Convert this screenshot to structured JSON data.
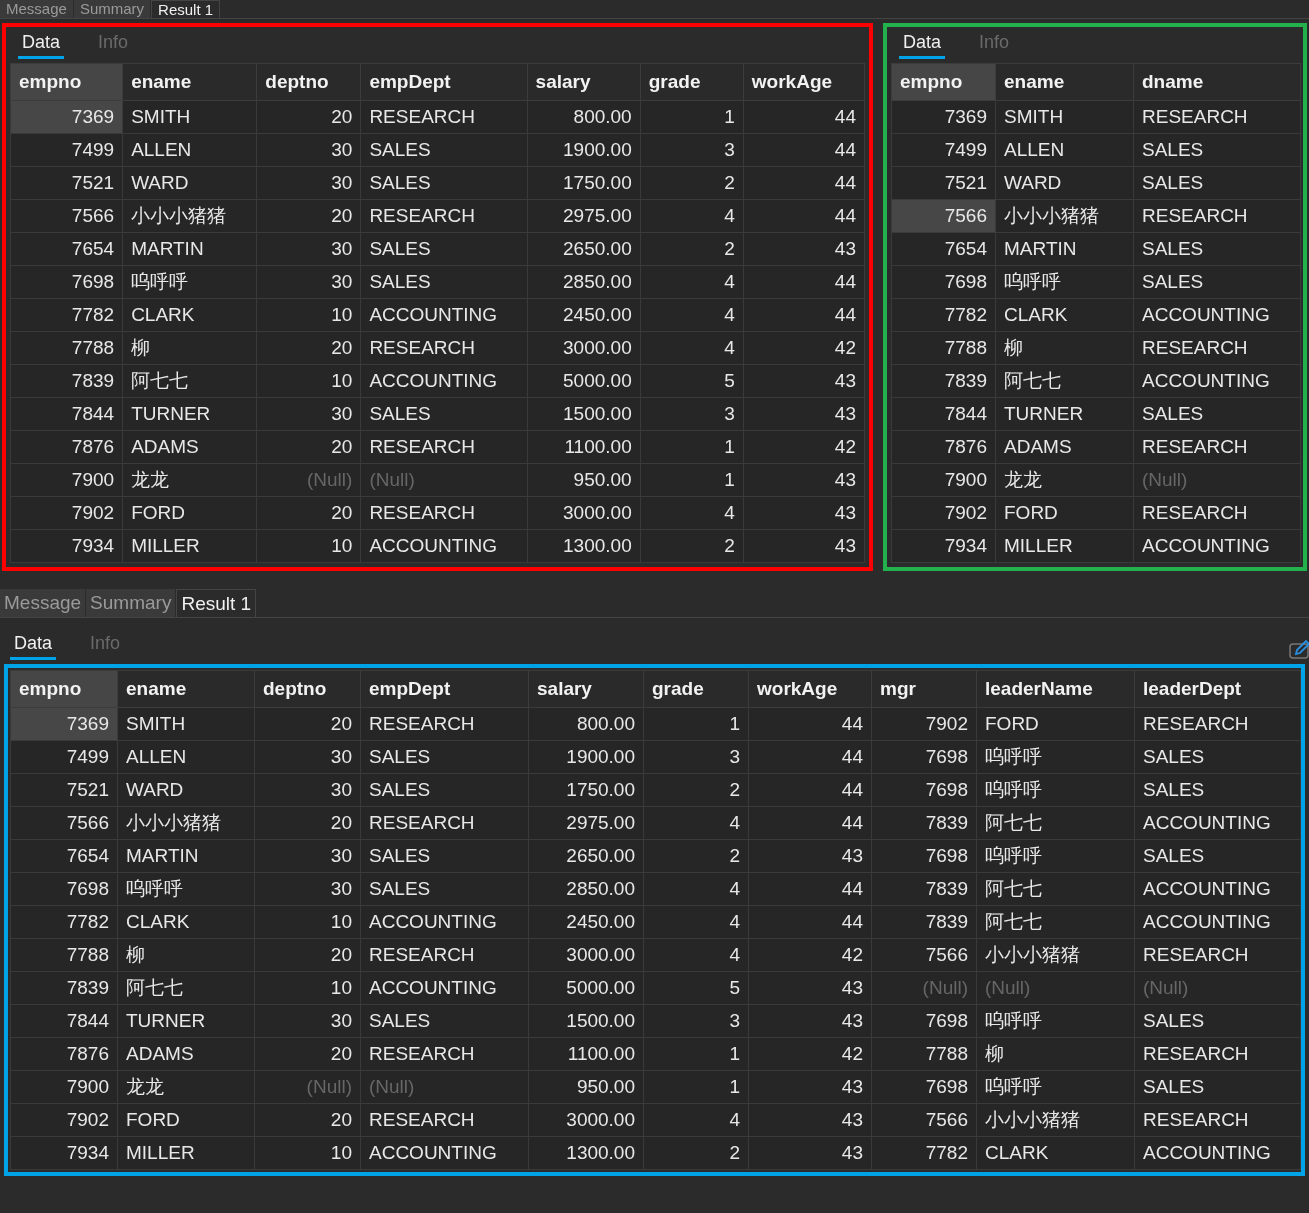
{
  "top_tabs": [
    {
      "label": "Message",
      "selected": false
    },
    {
      "label": "Summary",
      "selected": false
    },
    {
      "label": "Result 1",
      "selected": true
    }
  ],
  "panels": [
    {
      "sub_tabs": [
        {
          "label": "Data",
          "selected": true
        },
        {
          "label": "Info",
          "selected": false
        }
      ],
      "color": "#ff0000",
      "columns": [
        {
          "label": "empno",
          "kind": "number"
        },
        {
          "label": "ename",
          "kind": "text"
        },
        {
          "label": "deptno",
          "kind": "number"
        },
        {
          "label": "empDept",
          "kind": "text"
        },
        {
          "label": "salary",
          "kind": "number"
        },
        {
          "label": "grade",
          "kind": "number"
        },
        {
          "label": "workAge",
          "kind": "number"
        }
      ],
      "rows": [
        {
          "selected": true,
          "cells": [
            "7369",
            "SMITH",
            "20",
            "RESEARCH",
            "800.00",
            "1",
            "44"
          ]
        },
        {
          "selected": false,
          "cells": [
            "7499",
            "ALLEN",
            "30",
            "SALES",
            "1900.00",
            "3",
            "44"
          ]
        },
        {
          "selected": false,
          "cells": [
            "7521",
            "WARD",
            "30",
            "SALES",
            "1750.00",
            "2",
            "44"
          ]
        },
        {
          "selected": false,
          "cells": [
            "7566",
            "小小小猪猪",
            "20",
            "RESEARCH",
            "2975.00",
            "4",
            "44"
          ]
        },
        {
          "selected": false,
          "cells": [
            "7654",
            "MARTIN",
            "30",
            "SALES",
            "2650.00",
            "2",
            "43"
          ]
        },
        {
          "selected": false,
          "cells": [
            "7698",
            "呜呼呼",
            "30",
            "SALES",
            "2850.00",
            "4",
            "44"
          ]
        },
        {
          "selected": false,
          "cells": [
            "7782",
            "CLARK",
            "10",
            "ACCOUNTING",
            "2450.00",
            "4",
            "44"
          ]
        },
        {
          "selected": false,
          "cells": [
            "7788",
            "柳",
            "20",
            "RESEARCH",
            "3000.00",
            "4",
            "42"
          ]
        },
        {
          "selected": false,
          "cells": [
            "7839",
            "阿七七",
            "10",
            "ACCOUNTING",
            "5000.00",
            "5",
            "43"
          ]
        },
        {
          "selected": false,
          "cells": [
            "7844",
            "TURNER",
            "30",
            "SALES",
            "1500.00",
            "3",
            "43"
          ]
        },
        {
          "selected": false,
          "cells": [
            "7876",
            "ADAMS",
            "20",
            "RESEARCH",
            "1100.00",
            "1",
            "42"
          ]
        },
        {
          "selected": false,
          "cells": [
            "7900",
            "龙龙",
            {
              "text": "(Null)",
              "null": true
            },
            {
              "text": "(Null)",
              "null": true
            },
            "950.00",
            "1",
            "43"
          ]
        },
        {
          "selected": false,
          "cells": [
            "7902",
            "FORD",
            "20",
            "RESEARCH",
            "3000.00",
            "4",
            "43"
          ]
        },
        {
          "selected": false,
          "cells": [
            "7934",
            "MILLER",
            "10",
            "ACCOUNTING",
            "1300.00",
            "2",
            "43"
          ]
        }
      ]
    },
    {
      "sub_tabs": [
        {
          "label": "Data",
          "selected": true
        },
        {
          "label": "Info",
          "selected": false
        }
      ],
      "color": "#22b14c",
      "columns": [
        {
          "label": "empno",
          "kind": "number"
        },
        {
          "label": "ename",
          "kind": "text"
        },
        {
          "label": "dname",
          "kind": "text"
        }
      ],
      "rows": [
        {
          "selected": false,
          "cells": [
            "7369",
            "SMITH",
            "RESEARCH"
          ]
        },
        {
          "selected": false,
          "cells": [
            "7499",
            "ALLEN",
            "SALES"
          ]
        },
        {
          "selected": false,
          "cells": [
            "7521",
            "WARD",
            "SALES"
          ]
        },
        {
          "selected": true,
          "cells": [
            "7566",
            "小小小猪猪",
            "RESEARCH"
          ]
        },
        {
          "selected": false,
          "cells": [
            "7654",
            "MARTIN",
            "SALES"
          ]
        },
        {
          "selected": false,
          "cells": [
            "7698",
            "呜呼呼",
            "SALES"
          ]
        },
        {
          "selected": false,
          "cells": [
            "7782",
            "CLARK",
            "ACCOUNTING"
          ]
        },
        {
          "selected": false,
          "cells": [
            "7788",
            "柳",
            "RESEARCH"
          ]
        },
        {
          "selected": false,
          "cells": [
            "7839",
            "阿七七",
            "ACCOUNTING"
          ]
        },
        {
          "selected": false,
          "cells": [
            "7844",
            "TURNER",
            "SALES"
          ]
        },
        {
          "selected": false,
          "cells": [
            "7876",
            "ADAMS",
            "RESEARCH"
          ]
        },
        {
          "selected": false,
          "cells": [
            "7900",
            "龙龙",
            {
              "text": "(Null)",
              "null": true
            }
          ]
        },
        {
          "selected": false,
          "cells": [
            "7902",
            "FORD",
            "RESEARCH"
          ]
        },
        {
          "selected": false,
          "cells": [
            "7934",
            "MILLER",
            "ACCOUNTING"
          ]
        }
      ]
    }
  ],
  "bottom": {
    "tabs": [
      {
        "label": "Message",
        "selected": false
      },
      {
        "label": "Summary",
        "selected": false
      },
      {
        "label": "Result 1",
        "selected": true
      }
    ],
    "sub_tabs": [
      {
        "label": "Data",
        "selected": true
      },
      {
        "label": "Info",
        "selected": false
      }
    ],
    "color": "#00a2e8",
    "columns": [
      {
        "label": "empno",
        "kind": "number"
      },
      {
        "label": "ename",
        "kind": "text"
      },
      {
        "label": "deptno",
        "kind": "number"
      },
      {
        "label": "empDept",
        "kind": "text"
      },
      {
        "label": "salary",
        "kind": "number"
      },
      {
        "label": "grade",
        "kind": "number"
      },
      {
        "label": "workAge",
        "kind": "number"
      },
      {
        "label": "mgr",
        "kind": "number"
      },
      {
        "label": "leaderName",
        "kind": "text"
      },
      {
        "label": "leaderDept",
        "kind": "text"
      }
    ],
    "rows": [
      {
        "selected": true,
        "cells": [
          "7369",
          "SMITH",
          "20",
          "RESEARCH",
          "800.00",
          "1",
          "44",
          "7902",
          "FORD",
          "RESEARCH"
        ]
      },
      {
        "selected": false,
        "cells": [
          "7499",
          "ALLEN",
          "30",
          "SALES",
          "1900.00",
          "3",
          "44",
          "7698",
          "呜呼呼",
          "SALES"
        ]
      },
      {
        "selected": false,
        "cells": [
          "7521",
          "WARD",
          "30",
          "SALES",
          "1750.00",
          "2",
          "44",
          "7698",
          "呜呼呼",
          "SALES"
        ]
      },
      {
        "selected": false,
        "cells": [
          "7566",
          "小小小猪猪",
          "20",
          "RESEARCH",
          "2975.00",
          "4",
          "44",
          "7839",
          "阿七七",
          "ACCOUNTING"
        ]
      },
      {
        "selected": false,
        "cells": [
          "7654",
          "MARTIN",
          "30",
          "SALES",
          "2650.00",
          "2",
          "43",
          "7698",
          "呜呼呼",
          "SALES"
        ]
      },
      {
        "selected": false,
        "cells": [
          "7698",
          "呜呼呼",
          "30",
          "SALES",
          "2850.00",
          "4",
          "44",
          "7839",
          "阿七七",
          "ACCOUNTING"
        ]
      },
      {
        "selected": false,
        "cells": [
          "7782",
          "CLARK",
          "10",
          "ACCOUNTING",
          "2450.00",
          "4",
          "44",
          "7839",
          "阿七七",
          "ACCOUNTING"
        ]
      },
      {
        "selected": false,
        "cells": [
          "7788",
          "柳",
          "20",
          "RESEARCH",
          "3000.00",
          "4",
          "42",
          "7566",
          "小小小猪猪",
          "RESEARCH"
        ]
      },
      {
        "selected": false,
        "cells": [
          "7839",
          "阿七七",
          "10",
          "ACCOUNTING",
          "5000.00",
          "5",
          "43",
          {
            "text": "(Null)",
            "null": true
          },
          {
            "text": "(Null)",
            "null": true
          },
          {
            "text": "(Null)",
            "null": true
          }
        ]
      },
      {
        "selected": false,
        "cells": [
          "7844",
          "TURNER",
          "30",
          "SALES",
          "1500.00",
          "3",
          "43",
          "7698",
          "呜呼呼",
          "SALES"
        ]
      },
      {
        "selected": false,
        "cells": [
          "7876",
          "ADAMS",
          "20",
          "RESEARCH",
          "1100.00",
          "1",
          "42",
          "7788",
          "柳",
          "RESEARCH"
        ]
      },
      {
        "selected": false,
        "cells": [
          "7900",
          "龙龙",
          {
            "text": "(Null)",
            "null": true
          },
          {
            "text": "(Null)",
            "null": true
          },
          "950.00",
          "1",
          "43",
          "7698",
          "呜呼呼",
          "SALES"
        ]
      },
      {
        "selected": false,
        "cells": [
          "7902",
          "FORD",
          "20",
          "RESEARCH",
          "3000.00",
          "4",
          "43",
          "7566",
          "小小小猪猪",
          "RESEARCH"
        ]
      },
      {
        "selected": false,
        "cells": [
          "7934",
          "MILLER",
          "10",
          "ACCOUNTING",
          "1300.00",
          "2",
          "43",
          "7782",
          "CLARK",
          "ACCOUNTING"
        ]
      }
    ]
  }
}
